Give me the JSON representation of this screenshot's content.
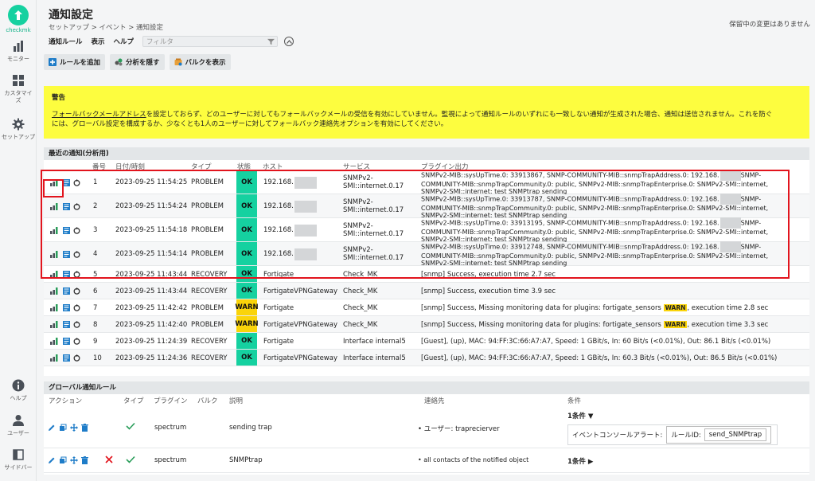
{
  "brand": {
    "name": "checkmk",
    "accent": "#15d1a0"
  },
  "sidebar": {
    "items": [
      {
        "label": "モニター",
        "icon": "bar-chart-icon"
      },
      {
        "label": "カスタマイズ",
        "icon": "grid-icon"
      },
      {
        "label": "セットアップ",
        "icon": "gear-icon"
      }
    ],
    "bottom": [
      {
        "label": "ヘルプ",
        "icon": "info-icon"
      },
      {
        "label": "ユーザー",
        "icon": "user-icon"
      },
      {
        "label": "サイドバー",
        "icon": "sidebar-icon"
      }
    ]
  },
  "header": {
    "title": "通知設定",
    "breadcrumb": "セットアップ > イベント > 通知設定",
    "pending": "保留中の変更はありません"
  },
  "menu": {
    "rules": "通知ルール",
    "display": "表示",
    "help": "ヘルプ",
    "filter_placeholder": "フィルタ"
  },
  "actions": {
    "add_rule": "ルールを追加",
    "hide_analysis": "分析を隠す",
    "show_bulk": "バルクを表示"
  },
  "warning": {
    "title": "警告",
    "link": "フォールバックメールアドレス",
    "text1": "を設定しておらず、どのユーザーに対してもフォールバックメールの受信を有効にしていません。監視によって通知ルールのいずれにも一致しない通知が生成された場合、通知は送信されません。これを防ぐ",
    "text2": "には、グローバル設定を構成するか、少なくとも1人のユーザーに対してフォールバック連絡先オプションを有効にしてください。"
  },
  "recent": {
    "title": "最近の通知(分析用)",
    "columns": {
      "num": "番号",
      "datetime": "日付/時刻",
      "type": "タイプ",
      "state": "状態",
      "host": "ホスト",
      "service": "サービス",
      "output": "プラグイン出力"
    },
    "rows": [
      {
        "num": "1",
        "datetime": "2023-09-25 11:54:25",
        "type": "PROBLEM",
        "state": "OK",
        "host": "192.168.",
        "service1": "SNMPv2-",
        "service2": "SMI::internet.0.17",
        "out1a": "SNMPv2-MIB::sysUpTime.0: 33913867, SNMP-COMMUNITY-MIB::snmpTrapAddress.0: 192.168.",
        "out1b": "SNMP-",
        "out2": "COMMUNITY-MIB::snmpTrapCommunity.0: public, SNMPv2-MIB::snmpTrapEnterprise.0: SNMPv2-SMI::internet,",
        "out3": "SNMPv2-SMI::internet: test SNMPtrap sending"
      },
      {
        "num": "2",
        "datetime": "2023-09-25 11:54:24",
        "type": "PROBLEM",
        "state": "OK",
        "host": "192.168.",
        "service1": "SNMPv2-",
        "service2": "SMI::internet.0.17",
        "out1a": "SNMPv2-MIB::sysUpTime.0: 33913787, SNMP-COMMUNITY-MIB::snmpTrapAddress.0: 192.168.",
        "out1b": "SNMP-",
        "out2": "COMMUNITY-MIB::snmpTrapCommunity.0: public, SNMPv2-MIB::snmpTrapEnterprise.0: SNMPv2-SMI::internet,",
        "out3": "SNMPv2-SMI::internet: test SNMPtrap sending"
      },
      {
        "num": "3",
        "datetime": "2023-09-25 11:54:18",
        "type": "PROBLEM",
        "state": "OK",
        "host": "192.168.",
        "service1": "SNMPv2-",
        "service2": "SMI::internet.0.17",
        "out1a": "SNMPv2-MIB::sysUpTime.0: 33913195, SNMP-COMMUNITY-MIB::snmpTrapAddress.0: 192.168.",
        "out1b": "SNMP-",
        "out2": "COMMUNITY-MIB::snmpTrapCommunity.0: public, SNMPv2-MIB::snmpTrapEnterprise.0: SNMPv2-SMI::internet,",
        "out3": "SNMPv2-SMI::internet: test SNMPtrap sending"
      },
      {
        "num": "4",
        "datetime": "2023-09-25 11:54:14",
        "type": "PROBLEM",
        "state": "OK",
        "host": "192.168.",
        "service1": "SNMPv2-",
        "service2": "SMI::internet.0.17",
        "out1a": "SNMPv2-MIB::sysUpTime.0: 33912748, SNMP-COMMUNITY-MIB::snmpTrapAddress.0: 192.168.",
        "out1b": "SNMP-",
        "out2": "COMMUNITY-MIB::snmpTrapCommunity.0: public, SNMPv2-MIB::snmpTrapEnterprise.0: SNMPv2-SMI::internet,",
        "out3": "SNMPv2-SMI::internet: test SNMPtrap sending"
      },
      {
        "num": "5",
        "datetime": "2023-09-25 11:43:44",
        "type": "RECOVERY",
        "state": "OK",
        "host": "Fortigate",
        "service": "Check_MK",
        "output": "[snmp] Success, execution time 2.7 sec"
      },
      {
        "num": "6",
        "datetime": "2023-09-25 11:43:44",
        "type": "RECOVERY",
        "state": "OK",
        "host": "FortigateVPNGateway",
        "service": "Check_MK",
        "output": "[snmp] Success, execution time 3.9 sec"
      },
      {
        "num": "7",
        "datetime": "2023-09-25 11:42:42",
        "type": "PROBLEM",
        "state": "WARN",
        "host": "Fortigate",
        "service": "Check_MK",
        "out_a": "[snmp] Success, Missing monitoring data for plugins: fortigate_sensors",
        "badge": "WARN",
        "out_b": ", execution time 2.8 sec"
      },
      {
        "num": "8",
        "datetime": "2023-09-25 11:42:40",
        "type": "PROBLEM",
        "state": "WARN",
        "host": "FortigateVPNGateway",
        "service": "Check_MK",
        "out_a": "[snmp] Success, Missing monitoring data for plugins: fortigate_sensors",
        "badge": "WARN",
        "out_b": ", execution time 3.3 sec"
      },
      {
        "num": "9",
        "datetime": "2023-09-25 11:24:39",
        "type": "RECOVERY",
        "state": "OK",
        "host": "Fortigate",
        "service": "Interface internal5",
        "output": "[Guest], (up), MAC: 94:FF:3C:66:A7:A7, Speed: 1 GBit/s, In: 60 Bit/s (<0.01%), Out: 86.1 Bit/s (<0.01%)"
      },
      {
        "num": "10",
        "datetime": "2023-09-25 11:24:36",
        "type": "RECOVERY",
        "state": "OK",
        "host": "FortigateVPNGateway",
        "service": "Interface internal5",
        "output": "[Guest], (up), MAC: 94:FF:3C:66:A7:A7, Speed: 1 GBit/s, In: 60.3 Bit/s (<0.01%), Out: 86.5 Bit/s (<0.01%)"
      }
    ]
  },
  "global": {
    "title": "グローバル通知ルール",
    "columns": {
      "actions": "アクション",
      "type": "タイプ",
      "plugin": "プラグイン",
      "bulk": "バルク",
      "desc": "説明",
      "contact": "連絡先",
      "cond": "条件"
    },
    "rows": [
      {
        "plugin": "spectrum",
        "desc": "sending trap",
        "contact": "ユーザー: traprecierver",
        "cond": "1条件 ▼",
        "cond_label": "イベントコンソールアラート:",
        "rule_id_label": "ルールID:",
        "rule_id": "send_SNMPtrap"
      },
      {
        "plugin": "spectrum",
        "desc": "SNMPtrap",
        "contact": "all contacts of the notified object",
        "cond": "1条件 ▶"
      }
    ]
  },
  "colors": {
    "ok": "#15d1a0",
    "warn": "#fad40a",
    "warning_bg": "#fdfd3f",
    "highlight": "#e2141d"
  }
}
